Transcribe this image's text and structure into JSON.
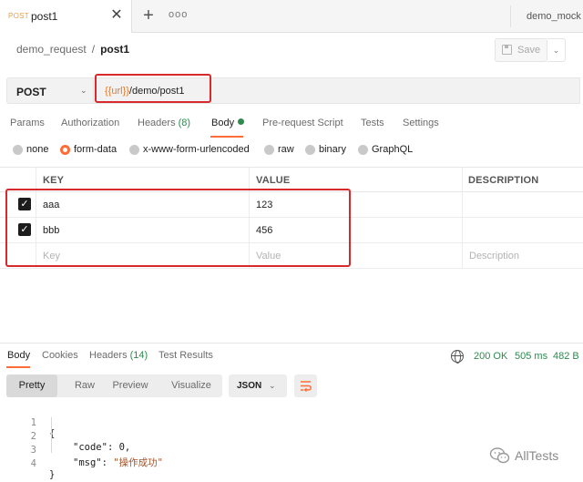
{
  "tabs": {
    "active_method": "POST",
    "active_name": "post1",
    "close_glyph": "✕",
    "add_glyph": "+",
    "more_glyph": "ooo",
    "environment": "demo_mock"
  },
  "breadcrumb": {
    "parent": "demo_request",
    "separator": "/",
    "current": "post1"
  },
  "save": {
    "label": "Save",
    "dropdown_glyph": "⌄"
  },
  "request": {
    "method": "POST",
    "method_caret": "⌄",
    "url_variable": "{{url}}",
    "url_path": "/demo/post1"
  },
  "request_tabs": {
    "params": "Params",
    "authorization": "Authorization",
    "headers": "Headers",
    "headers_count": "(8)",
    "body": "Body",
    "prerequest": "Pre-request Script",
    "tests": "Tests",
    "settings": "Settings"
  },
  "body_types": {
    "none": "none",
    "form_data": "form-data",
    "urlencoded": "x-www-form-urlencoded",
    "raw": "raw",
    "binary": "binary",
    "graphql": "GraphQL",
    "selected": "form-data"
  },
  "form_table": {
    "headers": {
      "key": "KEY",
      "value": "VALUE",
      "description": "DESCRIPTION"
    },
    "rows": [
      {
        "key": "aaa",
        "value": "123",
        "checked": true
      },
      {
        "key": "bbb",
        "value": "456",
        "checked": true
      }
    ],
    "placeholder": {
      "key": "Key",
      "value": "Value",
      "description": "Description"
    }
  },
  "response": {
    "tabs": {
      "body": "Body",
      "cookies": "Cookies",
      "headers": "Headers",
      "headers_count": "(14)",
      "test_results": "Test Results"
    },
    "status": "200 OK",
    "time": "505 ms",
    "size": "482 B",
    "views": {
      "pretty": "Pretty",
      "raw": "Raw",
      "preview": "Preview",
      "visualize": "Visualize"
    },
    "format": "JSON",
    "format_caret": "⌄",
    "lines": {
      "l1": {
        "num": "1",
        "text": "{"
      },
      "l2": {
        "num": "2",
        "key": "\"code\"",
        "sep": ": ",
        "value": "0",
        "tail": ","
      },
      "l3": {
        "num": "3",
        "key": "\"msg\"",
        "sep": ": ",
        "value": "\"操作成功\""
      },
      "l4": {
        "num": "4",
        "text": "}"
      }
    }
  },
  "watermark": "AllTests",
  "colors": {
    "accent": "#ff6c37",
    "success": "#2e8a4f",
    "highlight_box": "#d8292c",
    "url_variable": "#e8792c"
  }
}
